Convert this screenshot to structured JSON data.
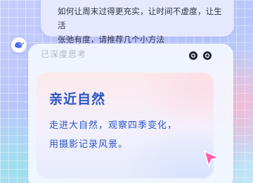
{
  "user_message": {
    "line1": "如何让周末过得更充实，让时间不虚度，让生活",
    "line2": "张弛有度，请推荐几个小方法"
  },
  "assistant": {
    "avatar_icon": "whale-icon",
    "thinking_label": "已深度思考",
    "answer_title": "亲近自然",
    "answer_line1": "走进大自然，观察四季变化，",
    "answer_line2": "用摄影记录风景。"
  },
  "icons": {
    "left_control": "record-icon",
    "right_control": "eye-icon",
    "cursor": "pointer-cursor-icon"
  },
  "colors": {
    "accent": "#2a56c8",
    "bubble": "#e8eaff",
    "cursor_fill": "#ff5aa8"
  }
}
